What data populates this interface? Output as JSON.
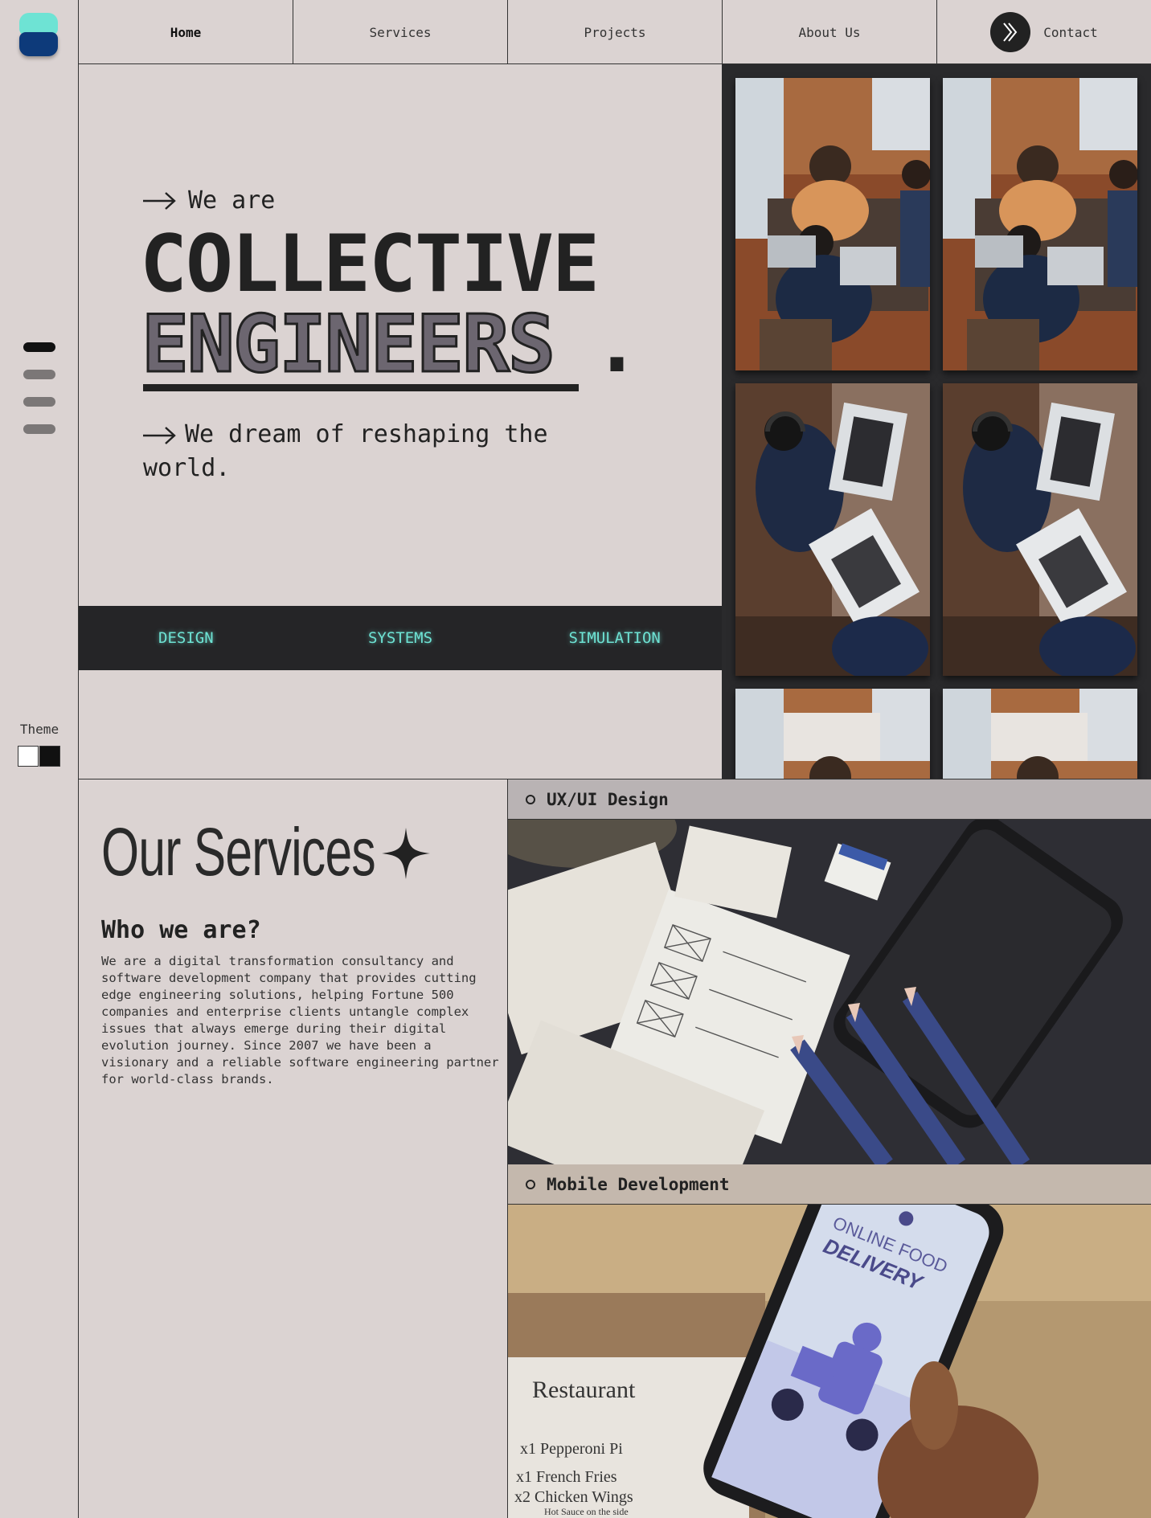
{
  "nav": {
    "items": [
      {
        "label": "Home"
      },
      {
        "label": "Services"
      },
      {
        "label": "Projects"
      },
      {
        "label": "About Us"
      },
      {
        "label": "Contact"
      }
    ]
  },
  "sidebar": {
    "theme_label": "Theme",
    "pager_count": 4,
    "active_page": 1
  },
  "hero": {
    "intro": "We are",
    "headline_1": "COLLECTIVE",
    "headline_2": "ENGINEERS",
    "headline_dot": ".",
    "tagline": "We dream of reshaping the world."
  },
  "ribbon": {
    "items": [
      "DESIGN",
      "SYSTEMS",
      "SIMULATION"
    ]
  },
  "services": {
    "title": "Our Services",
    "who_title": "Who we are?",
    "who_body": "We are a digital transformation consultancy and software development company that provides cutting edge engineering solutions, helping Fortune 500 companies and enterprise clients untangle complex issues that always emerge during their digital evolution journey. Since 2007 we have been a visionary and a reliable software engineering partner for world-class brands.",
    "cards": [
      {
        "label": "UX/UI Design"
      },
      {
        "label": "Mobile Development"
      }
    ]
  },
  "mockup_text": {
    "online_food": "ONLINE FOOD",
    "delivery": "DELIVERY",
    "restaurant": "Restaurant",
    "line1": "x1 Pepperoni Pi",
    "line2": "x1 French Fries",
    "line3": "x2 Chicken Wings",
    "line4": "Hot Sauce on the side"
  },
  "colors": {
    "background": "#dbd3d2",
    "accent": "#6ee3d4",
    "dark": "#252527",
    "logo_top": "#6ee3d4",
    "logo_bottom": "#0d3a7a"
  }
}
